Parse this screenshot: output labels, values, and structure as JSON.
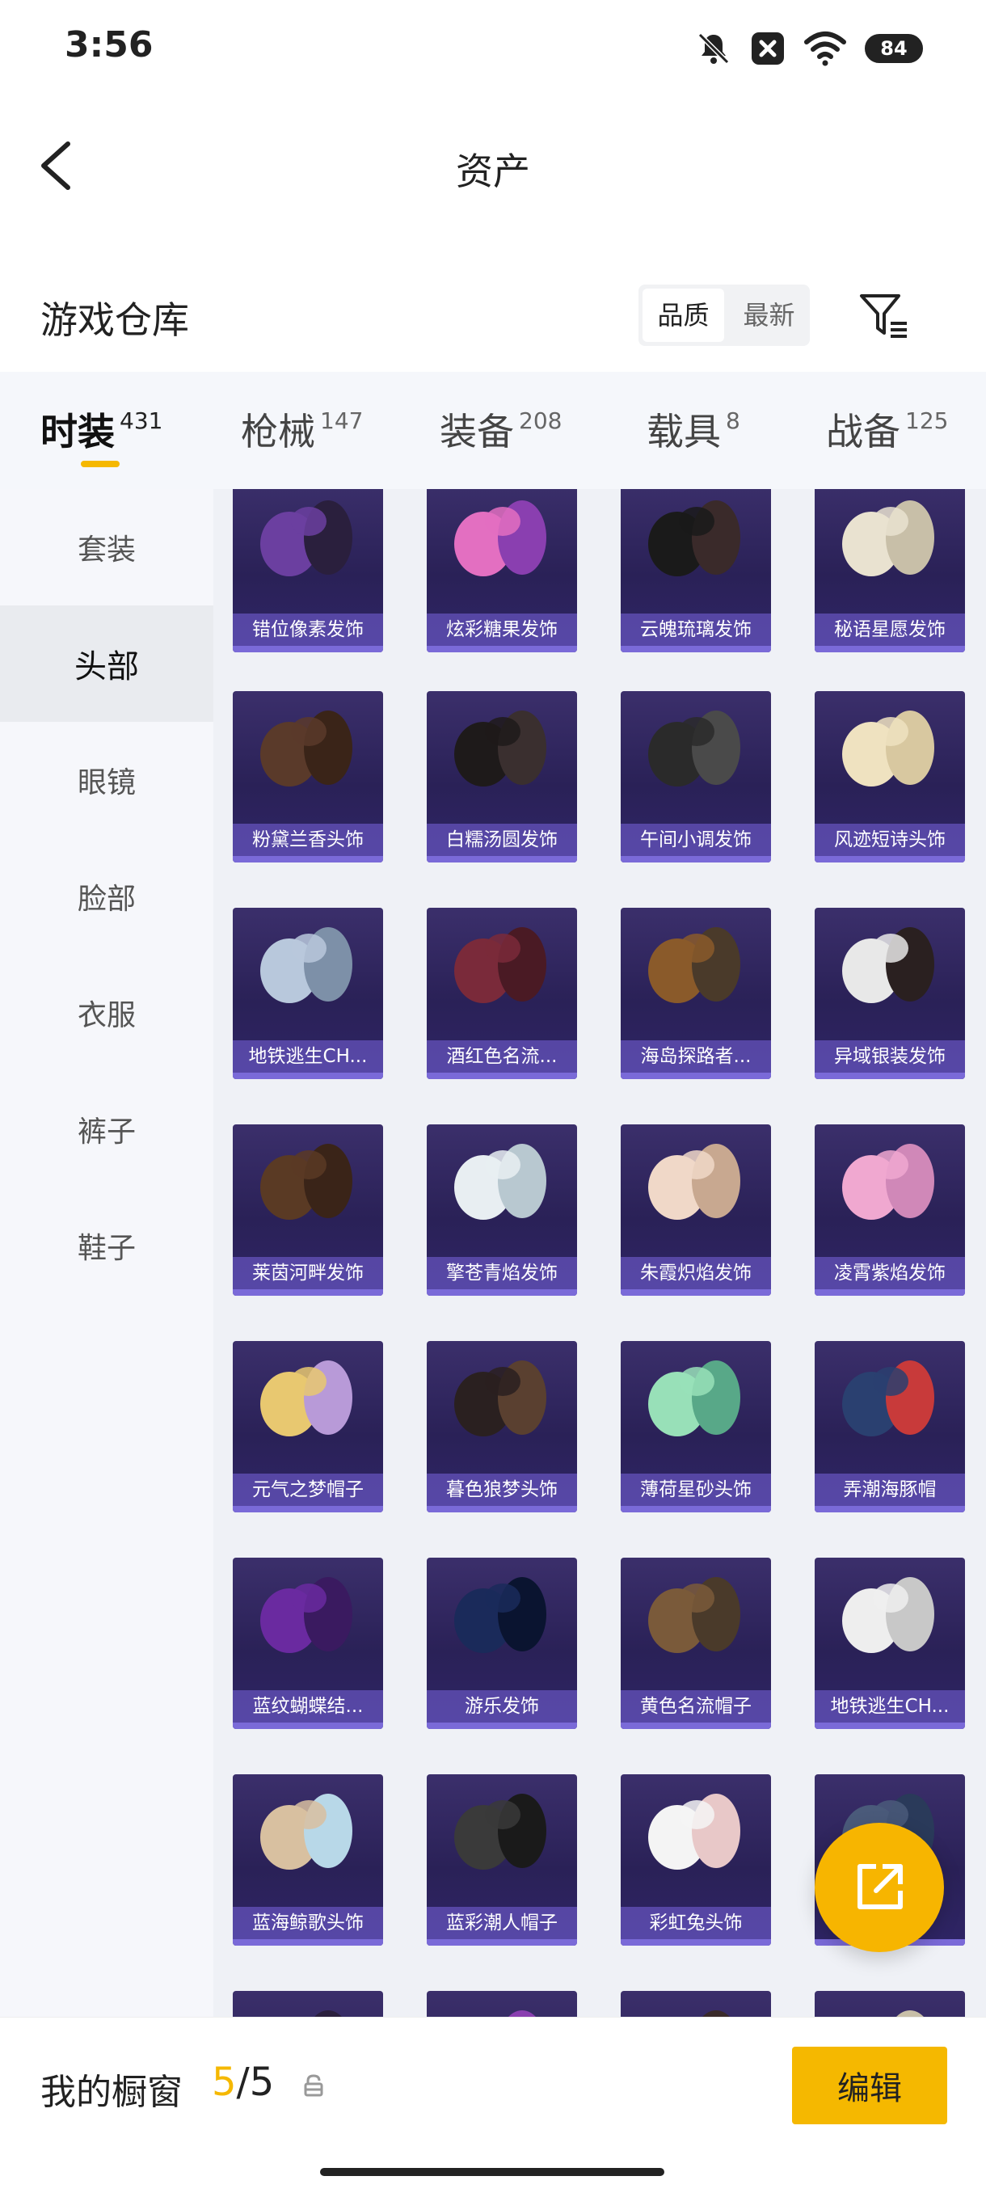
{
  "status": {
    "time": "3:56",
    "battery": "84"
  },
  "header": {
    "title": "资产"
  },
  "warehouse": {
    "title": "游戏仓库",
    "sort_options": [
      "品质",
      "最新"
    ],
    "active_sort": "品质"
  },
  "tabs": [
    {
      "label": "时装",
      "count": "431"
    },
    {
      "label": "枪械",
      "count": "147"
    },
    {
      "label": "装备",
      "count": "208"
    },
    {
      "label": "载具",
      "count": "8"
    },
    {
      "label": "战备",
      "count": "125"
    }
  ],
  "sidebar": [
    "套装",
    "头部",
    "眼镜",
    "脸部",
    "衣服",
    "裤子",
    "鞋子"
  ],
  "items": [
    "错位像素发饰",
    "炫彩糖果发饰",
    "云魄琉璃发饰",
    "秘语星愿发饰",
    "粉黛兰香头饰",
    "白糯汤圆发饰",
    "午间小调发饰",
    "风迹短诗头饰",
    "地铁逃生CH...",
    "酒红色名流...",
    "海岛探路者...",
    "异域银装发饰",
    "莱茵河畔发饰",
    "擎苍青焰发饰",
    "朱霞炽焰发饰",
    "凌霄紫焰发饰",
    "元气之梦帽子",
    "暮色狼梦头饰",
    "薄荷星砂头饰",
    "弄潮海豚帽",
    "蓝纹蝴蝶结...",
    "游乐发饰",
    "黄色名流帽子",
    "地铁逃生CH...",
    "蓝海鲸歌头饰",
    "蓝彩潮人帽子",
    "彩虹兔头饰",
    ""
  ],
  "bottom": {
    "window_label": "我的橱窗",
    "window_current": "5",
    "window_total": "/5",
    "edit_label": "编辑"
  }
}
